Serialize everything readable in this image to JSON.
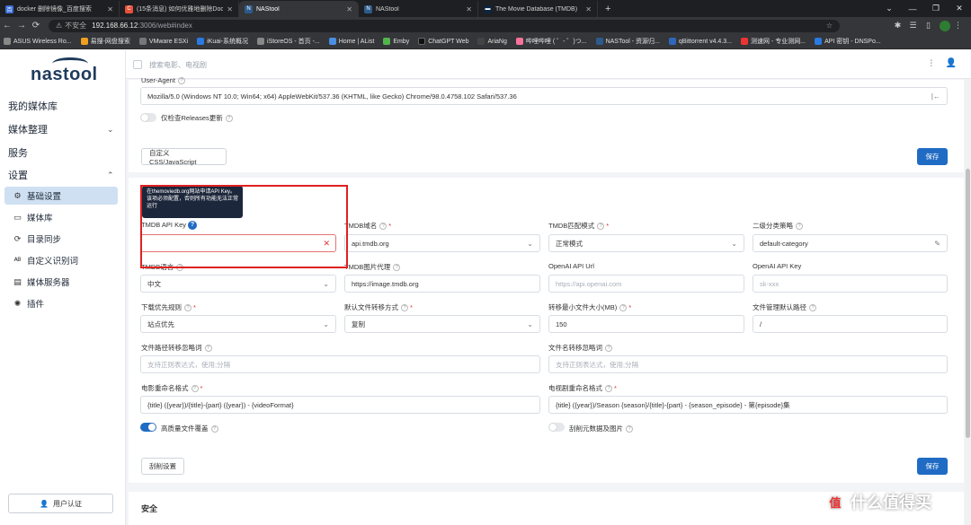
{
  "browser": {
    "tabs": [
      {
        "label": "docker 删除镜像_百度搜索",
        "color": "#3b6fd9",
        "glyph": "百"
      },
      {
        "label": "(15条消息) 如何优雅地删除Dock",
        "color": "#e8503a",
        "glyph": "C"
      },
      {
        "label": "NAStool",
        "color": "#2d5b8c",
        "glyph": "N",
        "active": true
      },
      {
        "label": "NAStool",
        "color": "#2d5b8c",
        "glyph": "N"
      },
      {
        "label": "The Movie Database (TMDB)",
        "color": "#0d253f",
        "glyph": "▬"
      }
    ],
    "newtab": "+",
    "insecure": "不安全",
    "host": "192.168.66.12",
    "path": ":3006/web#index",
    "bookmarks": [
      {
        "label": "ASUS Wireless Ro...",
        "color": "#888"
      },
      {
        "label": "易搜-网盘搜索",
        "color": "#f0a020"
      },
      {
        "label": "VMware ESXi",
        "color": "#777"
      },
      {
        "label": "iKuai-系统概况",
        "color": "#2a7ae2"
      },
      {
        "label": "iStoreOS - 首页 -...",
        "color": "#888"
      },
      {
        "label": "Home | AList",
        "color": "#4a90e2"
      },
      {
        "label": "Emby",
        "color": "#52b54b"
      },
      {
        "label": "ChatGPT Web",
        "color": "#222"
      },
      {
        "label": "AriaNg",
        "color": "#444"
      },
      {
        "label": "哔哩哔哩 ( ゜- ゜)つ...",
        "color": "#fb7299"
      },
      {
        "label": "NASTool - 资源归...",
        "color": "#2d5b8c"
      },
      {
        "label": "qBittorrent v4.4.3...",
        "color": "#2f67ba"
      },
      {
        "label": "测速网 - 专业测网...",
        "color": "#e33"
      },
      {
        "label": "API 密钥 - DNSPo...",
        "color": "#2a7ae2"
      }
    ]
  },
  "sidebar": {
    "logo": "nastool",
    "media_library": "我的媒体库",
    "media_manage": "媒体整理",
    "services": "服务",
    "settings": "设置",
    "sub_items": [
      {
        "label": "基础设置",
        "icon": "gear-icon",
        "glyph": "⚙",
        "active": true
      },
      {
        "label": "媒体库",
        "icon": "library-icon",
        "glyph": "▭"
      },
      {
        "label": "目录同步",
        "icon": "sync-icon",
        "glyph": "⟳"
      },
      {
        "label": "自定义识别词",
        "icon": "abc-icon",
        "glyph": "ᴬᴮ"
      },
      {
        "label": "媒体服务器",
        "icon": "server-icon",
        "glyph": "▤"
      },
      {
        "label": "插件",
        "icon": "plugin-icon",
        "glyph": "✺"
      }
    ],
    "user_auth": "用户认证"
  },
  "search": {
    "placeholder": "搜索电影、电视剧"
  },
  "top_card": {
    "ua_label": "User-Agent",
    "ua_value": "Mozilla/5.0 (Windows NT 10.0; Win64; x64) AppleWebKit/537.36 (KHTML, like Gecko) Chrome/98.0.4758.102 Safari/537.36",
    "releases_label": "仅检查Releases更新",
    "custom_css": "自定义 CSS/JavaScript",
    "save": "保存"
  },
  "tooltip": {
    "text": "在themoviedb.org网站申请API Key。该项必须配置，否则所有功能无法正常运行"
  },
  "form": {
    "tmdb_key_label": "TMDB API Key",
    "tmdb_domain_label": "TMDB域名",
    "tmdb_domain_value": "api.tmdb.org",
    "tmdb_match_label": "TMDB匹配模式",
    "tmdb_match_value": "正常模式",
    "category_label": "二级分类策略",
    "category_value": "default-category",
    "tmdb_lang_label": "TMDB语言",
    "tmdb_lang_value": "中文",
    "tmdb_img_label": "TMDB图片代理",
    "tmdb_img_value": "https://image.tmdb.org",
    "openai_url_label": "OpenAI API Url",
    "openai_url_placeholder": "https://api.openai.com",
    "openai_key_label": "OpenAI API Key",
    "openai_key_placeholder": "sk-xxx",
    "download_rule_label": "下载优先规则",
    "download_rule_value": "站点优先",
    "transfer_mode_label": "默认文件转移方式",
    "transfer_mode_value": "复制",
    "min_size_label": "转移最小文件大小(MB)",
    "min_size_value": "150",
    "file_default_path_label": "文件管理默认路径",
    "file_default_path_value": "/",
    "path_ignore_label": "文件路径转移忽略词",
    "path_ignore_placeholder": "支持正则表达式，使用;分隔",
    "name_ignore_label": "文件名转移忽略词",
    "name_ignore_placeholder": "支持正则表达式，使用;分隔",
    "movie_rename_label": "电影重命名格式",
    "movie_rename_value": "{title} ({year})/{title}-{part} ({year}) - {videoFormat}",
    "tv_rename_label": "电视剧重命名格式",
    "tv_rename_value": "{title} ({year})/Season {season}/{title}-{part} - {season_episode} - 第{episode}集",
    "hq_overwrite_label": "高质量文件覆盖",
    "scrape_meta_label": "刮削元数据及图片",
    "scrape_settings": "刮削设置",
    "save": "保存"
  },
  "security": {
    "title": "安全"
  },
  "watermark": {
    "text": "什么值得买",
    "glyph": "值"
  }
}
